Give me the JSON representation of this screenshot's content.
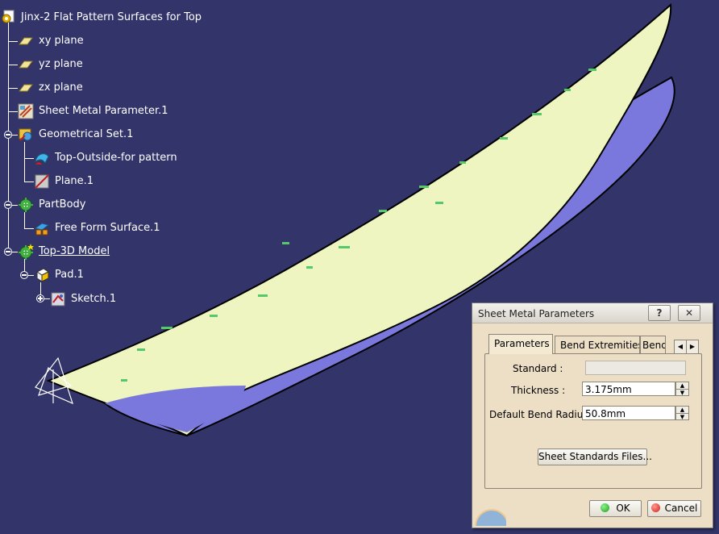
{
  "tree": {
    "root": {
      "label": "Jinx-2 Flat Pattern Surfaces for Top",
      "icon": "part-gear-icon"
    },
    "items": [
      {
        "label": "xy plane",
        "icon": "plane-icon"
      },
      {
        "label": "yz plane",
        "icon": "plane-icon"
      },
      {
        "label": "zx plane",
        "icon": "plane-icon"
      },
      {
        "label": "Sheet Metal Parameter.1",
        "icon": "sheet-metal-parameter-icon"
      },
      {
        "label": "Geometrical Set.1",
        "icon": "geometrical-set-icon"
      },
      {
        "label": "Top-Outside-for pattern",
        "icon": "surface-icon"
      },
      {
        "label": "Plane.1",
        "icon": "plane-feature-icon"
      },
      {
        "label": "PartBody",
        "icon": "partbody-gear-icon"
      },
      {
        "label": "Free Form Surface.1",
        "icon": "free-form-surface-icon"
      },
      {
        "label": "Top-3D Model",
        "icon": "body-gear-icon"
      },
      {
        "label": "Pad.1",
        "icon": "pad-icon"
      },
      {
        "label": "Sketch.1",
        "icon": "sketch-icon"
      }
    ]
  },
  "dialog": {
    "title": "Sheet Metal Parameters",
    "help_label": "?",
    "close_label": "✕",
    "tabs": [
      "Parameters",
      "Bend Extremities",
      "Bend"
    ],
    "active_tab": "Parameters",
    "tab_scroll_left": "◀",
    "tab_scroll_right": "▶",
    "standard_label": "Standard :",
    "standard_value": "",
    "thickness_label": "Thickness :",
    "thickness_value": "3.175mm",
    "bend_radius_label": "Default Bend Radius :",
    "bend_radius_value": "50.8mm",
    "spin_up": "▲",
    "spin_down": "▼",
    "standards_button": "Sheet Standards Files...",
    "ok_label": "OK",
    "cancel_label": "Cancel"
  },
  "colors": {
    "background": "#33346a",
    "surface_top": "#eef5c0",
    "surface_under": "#7a78dc",
    "ok_green": "#1aa320",
    "cancel_red": "#d02020",
    "dialog_bg": "#ecdfc6"
  }
}
